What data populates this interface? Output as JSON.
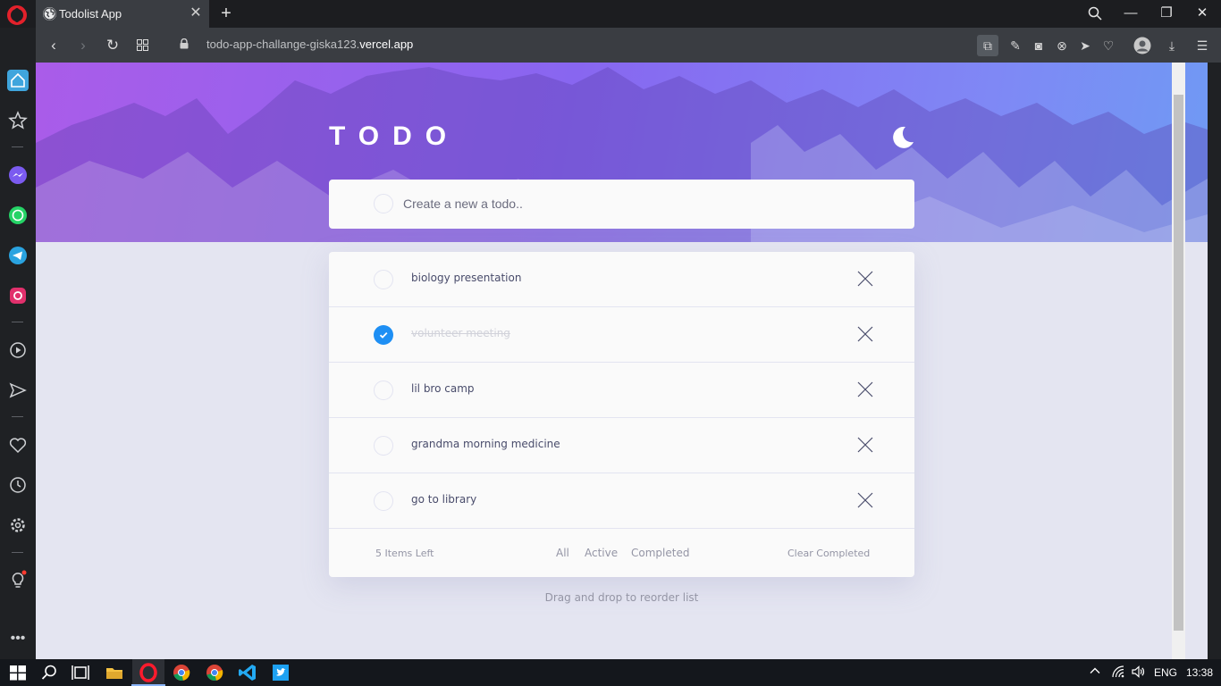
{
  "browser": {
    "tab_title": "Todolist App",
    "url_prefix": "todo-app-challange-giska123.",
    "url_domain": "vercel.app"
  },
  "app": {
    "title": "TODO",
    "theme_icon": "moon-icon",
    "new_todo_placeholder": "Create a new a todo..",
    "todos": [
      {
        "text": "biology presentation",
        "completed": false
      },
      {
        "text": "volunteer meeting",
        "completed": true
      },
      {
        "text": "lil bro camp",
        "completed": false
      },
      {
        "text": "grandma morning medicine",
        "completed": false
      },
      {
        "text": "go to library",
        "completed": false
      }
    ],
    "items_left": "5 Items Left",
    "filters": {
      "all": "All",
      "active": "Active",
      "completed": "Completed"
    },
    "clear_completed": "Clear Completed",
    "hint": "Drag and drop to reorder list",
    "colors": {
      "accent": "#1e8ff4",
      "text": "#494c6b",
      "muted": "#9495a5"
    }
  },
  "taskbar": {
    "language": "ENG",
    "time": "13:38"
  }
}
